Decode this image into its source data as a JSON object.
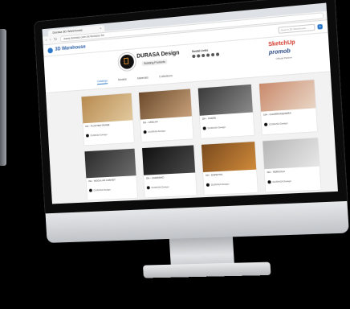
{
  "browser": {
    "tab_title": "Durasa 3D Warehouse",
    "tab_close": "×",
    "url": "www.durasa.com.br/durasa-3d",
    "nav_back": "‹",
    "nav_forward": "›",
    "nav_reload": "↻"
  },
  "site": {
    "logo_text": "3D Warehouse",
    "search_placeholder": "Search 3D Warehouse",
    "search_icon": "magnifier-icon"
  },
  "profile": {
    "name": "DURASA Design",
    "badge": "Building Products",
    "social_title": "Social Links",
    "partners": {
      "sketchup": "SketchUp",
      "promob": "promob",
      "promob_sub": "Official Partner"
    },
    "tabs": [
      {
        "label": "Catalogs",
        "active": true
      },
      {
        "label": "Models",
        "active": false
      },
      {
        "label": "Materials",
        "active": false
      },
      {
        "label": "Collections",
        "active": false
      }
    ]
  },
  "cards": [
    {
      "title": "DH - PLANTER FRAME",
      "author": "DURASA Design",
      "colors": [
        "#b88a4f",
        "#e1c99e"
      ]
    },
    {
      "title": "DH - GRELHA",
      "author": "DURASA Design",
      "colors": [
        "#6b4a2b",
        "#c7a07a"
      ]
    },
    {
      "title": "DH - CHEFE",
      "author": "DURASA Design",
      "colors": [
        "#3a3a3a",
        "#8a8a8a"
      ]
    },
    {
      "title": "DH - CHURRASQUEIRA",
      "author": "DURASA Design",
      "colors": [
        "#c98a6b",
        "#e9d6c6"
      ]
    },
    {
      "title": "DH - MODULAR CABINET",
      "author": "DURASA Design",
      "colors": [
        "#2b2b2b",
        "#6c6c6c"
      ]
    },
    {
      "title": "DH - CARRINHO",
      "author": "DURASA Design",
      "colors": [
        "#101010",
        "#4a4a4a"
      ]
    },
    {
      "title": "DH - ESPETOS",
      "author": "DURASA Design",
      "colors": [
        "#7a4a1e",
        "#d08a3a"
      ]
    },
    {
      "title": "DH - PERGOLA",
      "author": "DURASA Design",
      "colors": [
        "#b6b6b6",
        "#e7e7e7"
      ]
    }
  ]
}
